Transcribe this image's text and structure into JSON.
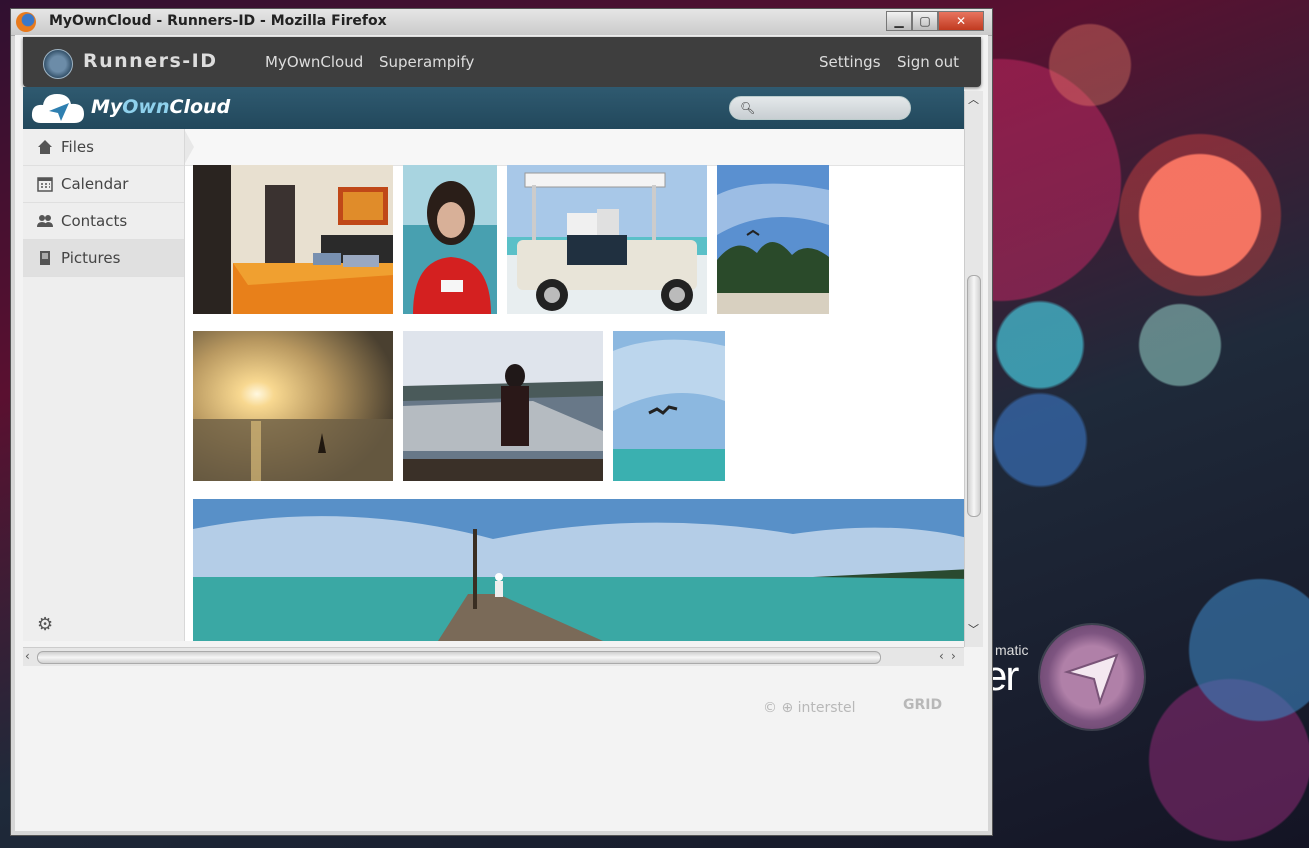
{
  "window": {
    "title": "MyOwnCloud - Runners-ID - Mozilla Firefox"
  },
  "topbar": {
    "brand": "Runners-ID",
    "nav": [
      "MyOwnCloud",
      "Superampify"
    ],
    "right": [
      "Settings",
      "Sign out"
    ]
  },
  "owncloud": {
    "title_prefix": "My",
    "title_own": "Own",
    "title_suffix": "Cloud",
    "search_placeholder": ""
  },
  "sidebar": {
    "items": [
      {
        "label": "Files",
        "icon": "home-icon"
      },
      {
        "label": "Calendar",
        "icon": "calendar-icon"
      },
      {
        "label": "Contacts",
        "icon": "contacts-icon"
      },
      {
        "label": "Pictures",
        "icon": "pictures-icon",
        "active": true
      }
    ]
  },
  "gallery": {
    "photos": [
      {
        "name": "bedroom"
      },
      {
        "name": "portrait"
      },
      {
        "name": "golf-cart-beach"
      },
      {
        "name": "palm-trees-bird"
      },
      {
        "name": "sunset-beach"
      },
      {
        "name": "boat-silhouette"
      },
      {
        "name": "bird-over-sea"
      },
      {
        "name": "pier-panorama"
      }
    ]
  },
  "footer": {
    "copyright": "© ⊕ interstel",
    "grid": "GRID"
  },
  "desktop": {
    "text_small": "matic",
    "text_large": "er"
  },
  "colors": {
    "topbar": "#3e3e3e",
    "owncloud_bar": "#2f5a70",
    "accent": "#8fd1ec"
  }
}
